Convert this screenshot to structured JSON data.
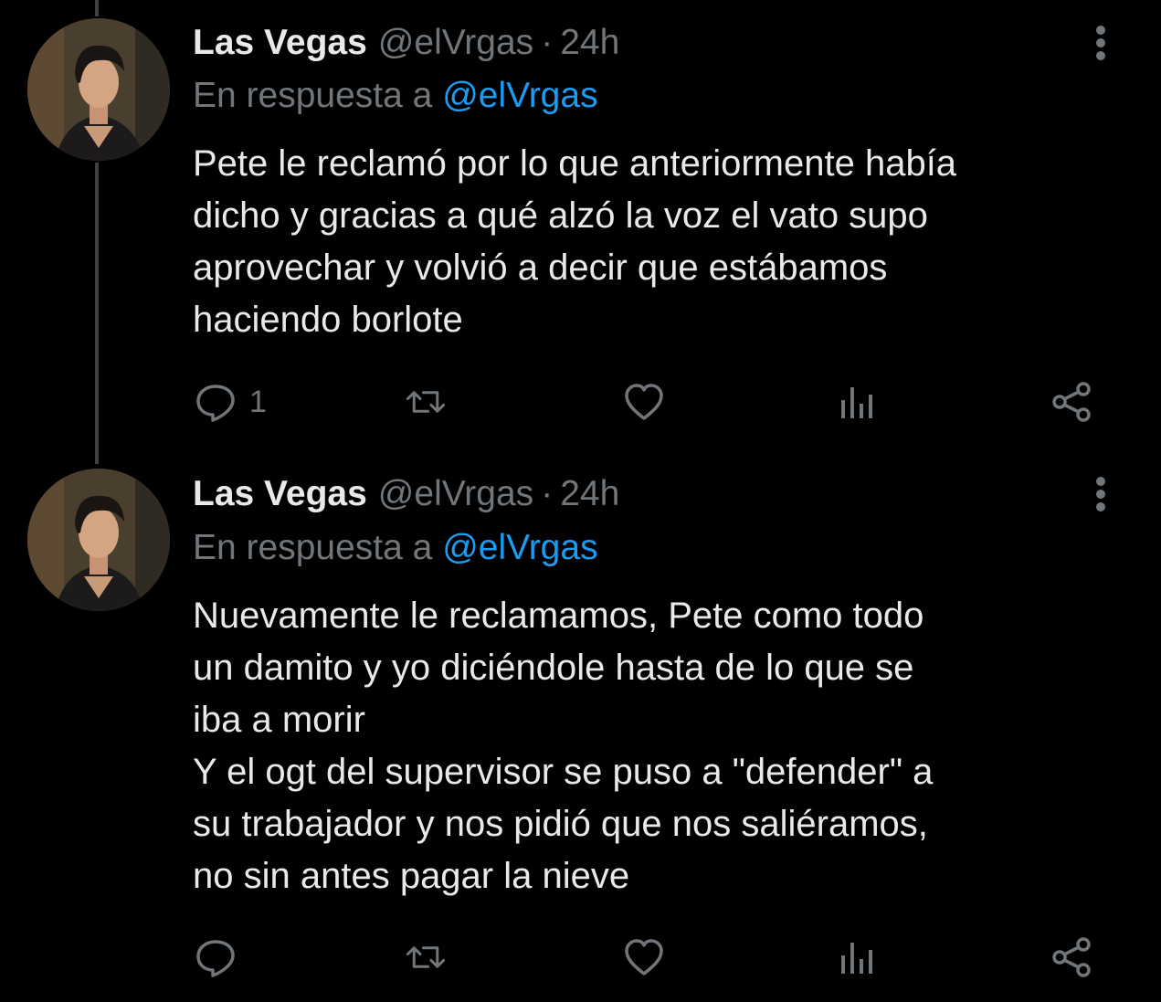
{
  "colors": {
    "background": "#000000",
    "text_primary": "#e7e9ea",
    "text_secondary": "#71767b",
    "link": "#1d9bf0",
    "thread_line": "#3d4248"
  },
  "tweets": [
    {
      "display_name": "Las Vegas",
      "handle": "@elVrgas",
      "separator": "·",
      "time": "24h",
      "reply_prefix": "En respuesta a",
      "reply_handle": "@elVrgas",
      "text": "Pete le reclamó por lo que anteriormente había\ndicho y gracias a qué alzó la voz el vato supo\naprovechar y volvió a decir que estábamos\nhaciendo borlote",
      "reply_count": "1",
      "icons": {
        "reply": "reply-bubble-icon",
        "retweet": "retweet-icon",
        "like": "heart-icon",
        "views": "views-bar-icon",
        "share": "share-icon",
        "more": "more-vertical-icon"
      }
    },
    {
      "display_name": "Las Vegas",
      "handle": "@elVrgas",
      "separator": "·",
      "time": "24h",
      "reply_prefix": "En respuesta a",
      "reply_handle": "@elVrgas",
      "text": "Nuevamente le reclamamos, Pete como todo\nun damito y yo diciéndole hasta de lo que se\niba a morir\nY el ogt del supervisor se puso a \"defender\" a\nsu trabajador y nos pidió que nos saliéramos,\nno sin antes pagar la nieve",
      "reply_count": "",
      "icons": {
        "reply": "reply-bubble-icon",
        "retweet": "retweet-icon",
        "like": "heart-icon",
        "views": "views-bar-icon",
        "share": "share-icon",
        "more": "more-vertical-icon"
      }
    }
  ]
}
